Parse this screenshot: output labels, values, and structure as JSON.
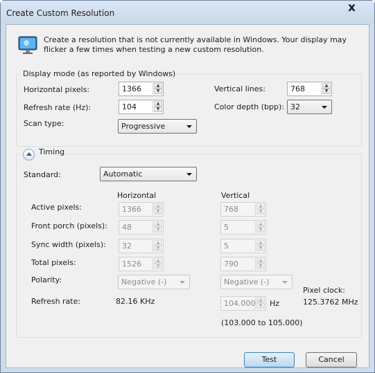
{
  "window": {
    "title": "Create Custom Resolution",
    "info_text": "Create a resolution that is not currently available in Windows. Your display may flicker a few times when testing a new custom resolution."
  },
  "display_mode": {
    "legend": "Display mode (as reported by Windows)",
    "horizontal_pixels_label": "Horizontal pixels:",
    "horizontal_pixels": "1366",
    "vertical_lines_label": "Vertical lines:",
    "vertical_lines": "768",
    "refresh_rate_label": "Refresh rate (Hz):",
    "refresh_rate": "104",
    "color_depth_label": "Color depth (bpp):",
    "color_depth": "32",
    "scan_type_label": "Scan type:",
    "scan_type": "Progressive"
  },
  "timing": {
    "legend": "Timing",
    "standard_label": "Standard:",
    "standard": "Automatic",
    "col_horizontal": "Horizontal",
    "col_vertical": "Vertical",
    "rows": [
      {
        "label": "Active pixels:",
        "h": "1366",
        "v": "768"
      },
      {
        "label": "Front porch (pixels):",
        "h": "48",
        "v": "5"
      },
      {
        "label": "Sync width (pixels):",
        "h": "32",
        "v": "5"
      },
      {
        "label": "Total pixels:",
        "h": "1526",
        "v": "790"
      }
    ],
    "polarity_label": "Polarity:",
    "polarity_h": "Negative (-)",
    "polarity_v": "Negative (-)",
    "refresh_rate_label": "Refresh rate:",
    "refresh_rate_h": "82.16 KHz",
    "refresh_rate_v": "104.000",
    "refresh_unit": "Hz",
    "refresh_range": "(103.000 to 105.000)",
    "pixel_clock_label": "Pixel clock:",
    "pixel_clock": "125.3762 MHz"
  },
  "buttons": {
    "test": "Test",
    "cancel": "Cancel"
  }
}
